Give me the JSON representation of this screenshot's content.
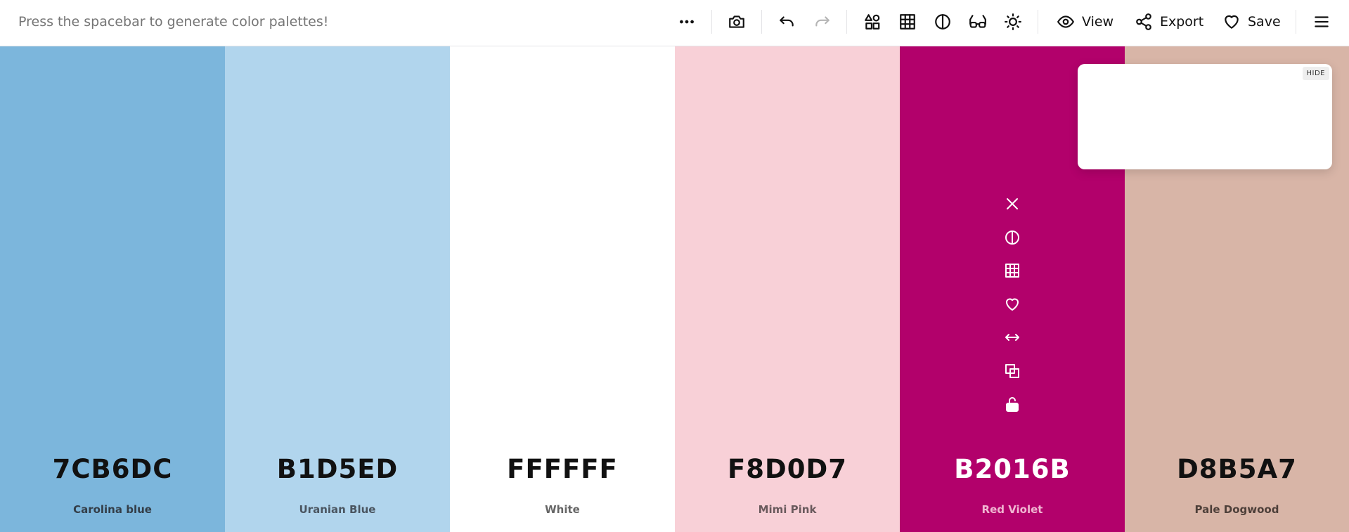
{
  "toolbar": {
    "hint": "Press the spacebar to generate color palettes!",
    "view_label": "View",
    "export_label": "Export",
    "save_label": "Save"
  },
  "palette": [
    {
      "hex": "7CB6DC",
      "name": "Carolina blue",
      "bg": "#7CB6DC",
      "text": "#111111",
      "name_color": "#333d47"
    },
    {
      "hex": "B1D5ED",
      "name": "Uranian Blue",
      "bg": "#B1D5ED",
      "text": "#111111",
      "name_color": "#4a5560"
    },
    {
      "hex": "FFFFFF",
      "name": "White",
      "bg": "#FFFFFF",
      "text": "#111111",
      "name_color": "#666666"
    },
    {
      "hex": "F8D0D7",
      "name": "Mimi Pink",
      "bg": "#F8D0D7",
      "text": "#111111",
      "name_color": "#6a5a5d"
    },
    {
      "hex": "B2016B",
      "name": "Red Violet",
      "bg": "#B2016B",
      "text": "#ffffff",
      "name_color": "#f0b6d2"
    },
    {
      "hex": "D8B5A7",
      "name": "Pale Dogwood",
      "bg": "#D8B5A7",
      "text": "#111111",
      "name_color": "#4d3f39"
    }
  ],
  "column_tools": [
    "close-icon",
    "contrast-icon",
    "grid-icon",
    "heart-icon",
    "drag-arrows-icon",
    "copy-icon",
    "unlock-icon"
  ],
  "popup": {
    "hide_label": "HIDE"
  }
}
